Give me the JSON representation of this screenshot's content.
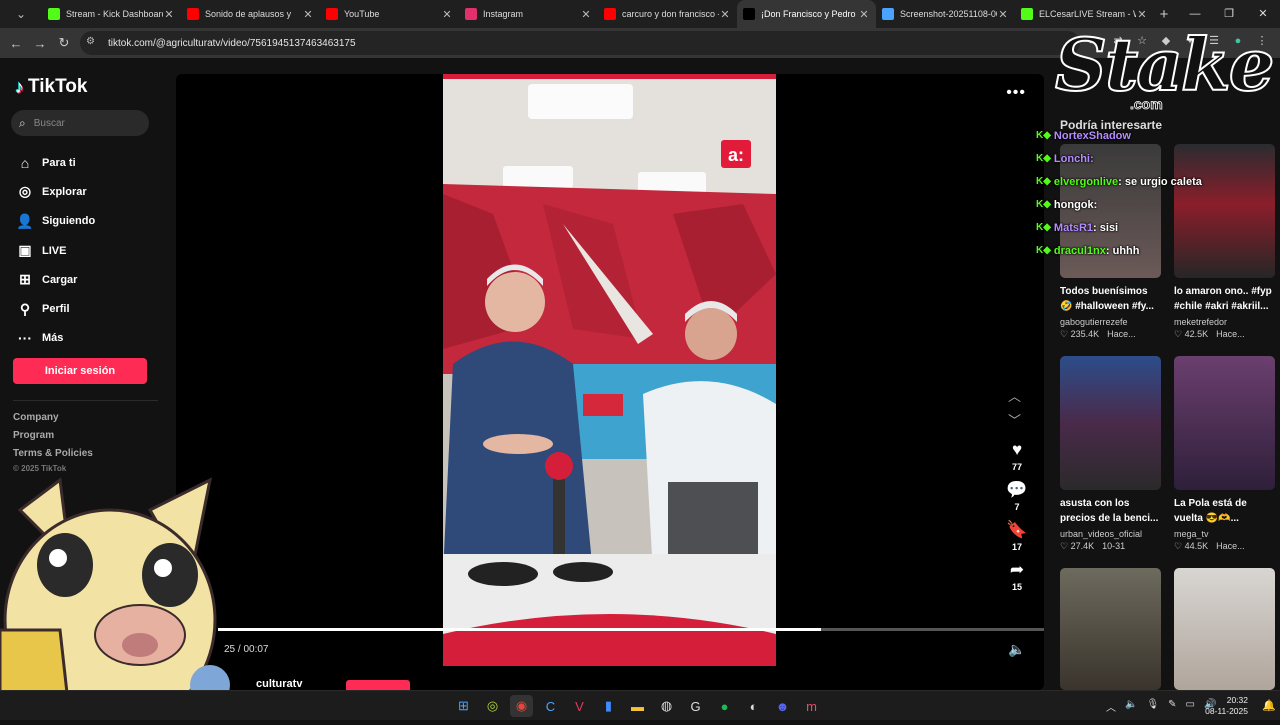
{
  "browser": {
    "tabs": [
      {
        "title": "Stream - Kick Dashboard",
        "favicon": "kick-icon",
        "color": "#53fc18",
        "active": false
      },
      {
        "title": "Sonido de aplausos y",
        "favicon": "youtube-icon",
        "color": "#ff0000",
        "active": false
      },
      {
        "title": "YouTube",
        "favicon": "youtube-icon",
        "color": "#ff0000",
        "active": false
      },
      {
        "title": "Instagram",
        "favicon": "instagram-icon",
        "color": "#e1306c",
        "active": false
      },
      {
        "title": "carcuro y don francisco -",
        "favicon": "youtube-icon",
        "color": "#ff0000",
        "active": false
      },
      {
        "title": "¡Don Francisco y Pedro C",
        "favicon": "tiktok-icon",
        "color": "#000000",
        "active": true
      },
      {
        "title": "Screenshot-20251108-00",
        "favicon": "image-icon",
        "color": "#4aa3ff",
        "active": false
      },
      {
        "title": "ELCesarLIVE Stream - W",
        "favicon": "kick-icon",
        "color": "#53fc18",
        "active": false
      }
    ],
    "url": "tiktok.com/@agriculturatv/video/7561945137463463175"
  },
  "sidebar": {
    "logo": "TikTok",
    "search_placeholder": "Buscar",
    "nav": [
      {
        "label": "Para ti",
        "icon": "home-icon"
      },
      {
        "label": "Explorar",
        "icon": "compass-icon"
      },
      {
        "label": "Siguiendo",
        "icon": "user-icon"
      },
      {
        "label": "LIVE",
        "icon": "live-icon"
      },
      {
        "label": "Cargar",
        "icon": "upload-icon"
      },
      {
        "label": "Perfil",
        "icon": "profile-icon"
      },
      {
        "label": "Más",
        "icon": "more-icon"
      }
    ],
    "login": "Iniciar sesión",
    "footer": [
      "Company",
      "Program",
      "Terms & Policies"
    ],
    "copyright": "© 2025 TikTok"
  },
  "video": {
    "actions": {
      "likes": "77",
      "comments": "7",
      "saves": "17",
      "shares": "15"
    },
    "time": "25 / 00:07",
    "progress": 0.73,
    "username": "culturatv"
  },
  "right": {
    "heading": "Podría interesarte",
    "cards": [
      {
        "title1": "Todos buenísimos",
        "title2": "🤣 #halloween #fy...",
        "user": "gabogutierrezefe",
        "likes": "235.4K",
        "when": "Hace..."
      },
      {
        "title1": "lo amaron ono.. #fyp",
        "title2": "#chile #akri #akriil...",
        "user": "meketrefedor",
        "likes": "42.5K",
        "when": "Hace..."
      },
      {
        "title1": "asusta con los",
        "title2": "precios de la benci...",
        "user": "urban_videos_oficial",
        "likes": "27.4K",
        "when": "10-31"
      },
      {
        "title1": "La Pola está de",
        "title2": "vuelta 😎🫶...",
        "user": "mega_tv",
        "likes": "44.5K",
        "when": "Hace..."
      }
    ]
  },
  "chat": [
    {
      "user": "NortexShadow",
      "msg": "",
      "color": "#b58cff"
    },
    {
      "user": "Lonchi:",
      "msg": "",
      "color": "#b58cff"
    },
    {
      "user": "elvergonlive",
      "msg": ": se urgio caleta",
      "color": "#53fc18"
    },
    {
      "user": "hongok",
      "msg": ":",
      "color": "#ffffff"
    },
    {
      "user": "MatsR1",
      "msg": ": sisi",
      "color": "#b58cff"
    },
    {
      "user": "dracul1nx",
      "msg": ": uhhh",
      "color": "#53fc18"
    }
  ],
  "overlay": {
    "stake": "Stake",
    "stake_com": ".com"
  },
  "taskbar": {
    "time": "20:32",
    "date": "08-11-2025"
  },
  "colors": {
    "tiktok_red": "#fe2c55",
    "kick_green": "#53fc18"
  }
}
